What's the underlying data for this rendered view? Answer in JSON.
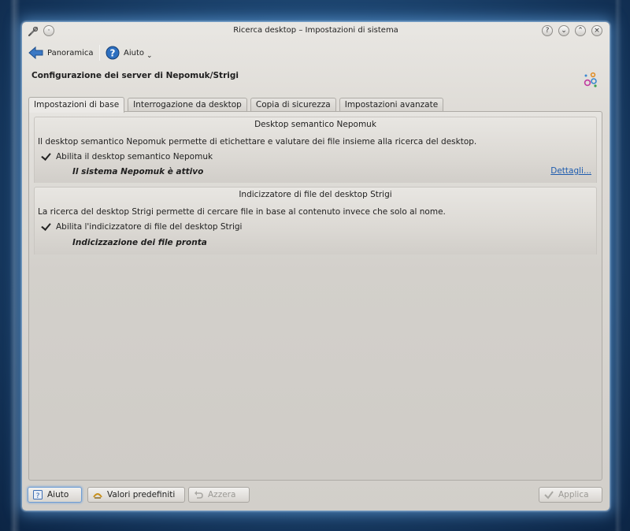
{
  "window": {
    "title": "Ricerca desktop – Impostazioni di sistema"
  },
  "toolbar": {
    "overview_label": "Panoramica",
    "help_label": "Aiuto"
  },
  "page": {
    "title": "Configurazione dei server di Nepomuk/Strigi"
  },
  "tabs": [
    {
      "label": "Impostazioni di base",
      "active": true
    },
    {
      "label": "Interrogazione da desktop",
      "active": false
    },
    {
      "label": "Copia di sicurezza",
      "active": false
    },
    {
      "label": "Impostazioni avanzate",
      "active": false
    }
  ],
  "nepomuk": {
    "title": "Desktop semantico Nepomuk",
    "description": "Il desktop semantico Nepomuk permette di etichettare e valutare dei file insieme alla ricerca del desktop.",
    "checkbox_label": "Abilita il desktop semantico Nepomuk",
    "checked": true,
    "status": "Il sistema Nepomuk è attivo",
    "details_link": "Dettagli..."
  },
  "strigi": {
    "title": "Indicizzatore di file del desktop Strigi",
    "description": "La ricerca del desktop Strigi permette di cercare file in base al contenuto invece che solo al nome.",
    "checkbox_label": "Abilita l'indicizzatore di file del desktop Strigi",
    "checked": true,
    "status": "Indicizzazione dei file pronta"
  },
  "buttons": {
    "help": "Aiuto",
    "defaults": "Valori predefiniti",
    "reset": "Azzera",
    "apply": "Applica"
  },
  "colors": {
    "link": "#1e5cae",
    "focus": "#6f9ed3"
  }
}
